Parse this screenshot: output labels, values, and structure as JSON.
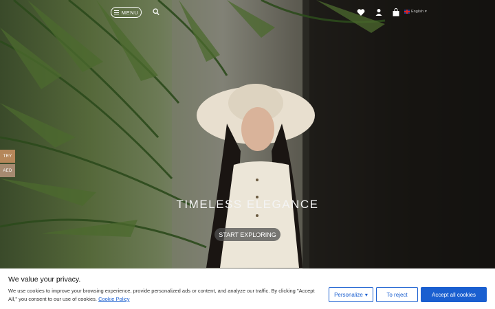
{
  "header": {
    "menu_label": "MENU",
    "language_label": "English",
    "icons": [
      "menu-icon",
      "search-icon",
      "heart-icon",
      "user-icon",
      "bag-icon",
      "uk-flag-icon",
      "chevron-down-icon"
    ]
  },
  "currency_tabs": [
    {
      "label": "TRY",
      "color": "#b5875a"
    },
    {
      "label": "AED",
      "color": "#a68a70"
    }
  ],
  "hero": {
    "title": "TIMELESS ELEGANCE",
    "cta_label": "START EXPLORING"
  },
  "cookie_banner": {
    "title": "We value your privacy.",
    "text": "We use cookies to improve your browsing experience, provide personalized ads or content, and analyze our traffic. By clicking \"Accept All,\" you consent to our use of cookies.",
    "link_label": "Cookie Policy",
    "personalize_label": "Personalize",
    "reject_label": "To reject",
    "accept_label": "Accept all cookies",
    "accent_color": "#1a5fd0"
  }
}
